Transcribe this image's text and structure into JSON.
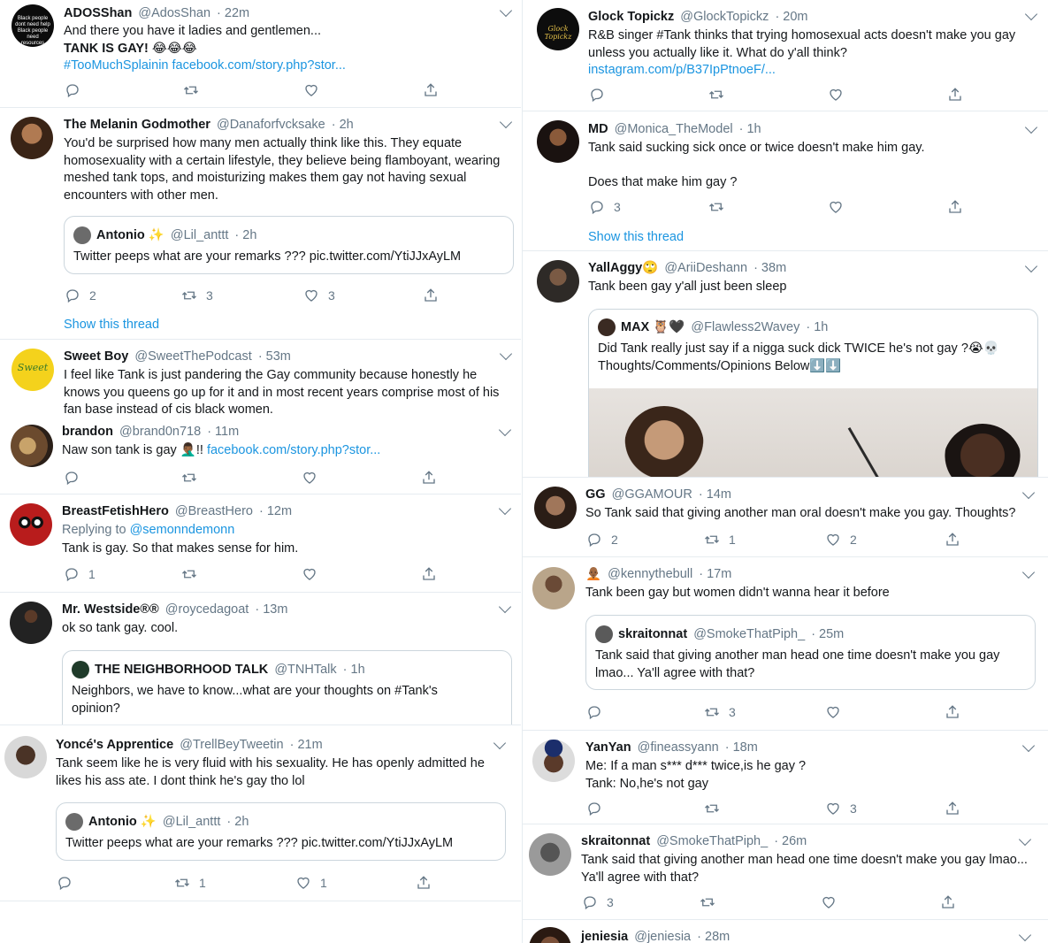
{
  "left": [
    {
      "name": "ADOSShan",
      "handle": "@AdosShan",
      "time": "· 22m",
      "lines": [
        "And there you have it ladies and gentlemen...",
        "TANK IS GAY! 😂😂😂"
      ],
      "links": [
        "#TooMuchSplainin facebook.com/story.php?stor..."
      ],
      "avatar_text": "Black people dont need help Black people need resources"
    },
    {
      "name": "The Melanin Godmother",
      "handle": "@Danaforfvcksake",
      "time": "· 2h",
      "text": "You'd be surprised how many men actually think like this. They equate homosexuality with a certain lifestyle, they believe being flamboyant, wearing meshed tank tops, and moisturizing makes them gay not having sexual encounters with other men.",
      "quote": {
        "name": "Antonio ✨",
        "handle": "@Lil_anttt",
        "time": "· 2h",
        "text": "Twitter peeps what are your remarks ??? pic.twitter.com/YtiJJxAyLM"
      },
      "counts": {
        "reply": "2",
        "retweet": "3",
        "like": "3"
      },
      "thread": "Show this thread"
    },
    {
      "name": "Sweet Boy",
      "handle": "@SweetThePodcast",
      "time": "· 53m",
      "text": "I feel like Tank is just pandering the Gay community because honestly he knows you queens go up for it and in most recent years comprise most of his fan base instead of cis black women.",
      "avatar_text": "Sweet"
    },
    {
      "name": "brandon",
      "handle": "@brand0n718",
      "time": "· 11m",
      "text_pre": "Naw son tank is gay 🤦🏾‍♂️!!",
      "link": "facebook.com/story.php?stor..."
    },
    {
      "name": "BreastFetishHero",
      "handle": "@BreastHero",
      "time": "· 12m",
      "replying": "Replying to",
      "replying_to": "@semonndemonn",
      "text": "Tank is gay. So that makes sense for him.",
      "counts": {
        "reply": "1"
      }
    },
    {
      "name": "Mr. Westside®®",
      "handle": "@roycedagoat",
      "time": "· 13m",
      "text": "ok so tank gay. cool.",
      "quote": {
        "name": "THE NEIGHBORHOOD TALK",
        "handle": "@TNHTalk",
        "time": "· 1h",
        "text": "Neighbors, we have to know...what are your thoughts on #Tank's opinion?"
      }
    },
    {
      "name": "Yoncé's Apprentice",
      "handle": "@TrellBeyTweetin",
      "time": "· 21m",
      "text": "Tank seem like he is very fluid with his sexuality. He has openly admitted he likes his ass ate. I dont think he's gay tho lol",
      "quote": {
        "name": "Antonio ✨",
        "handle": "@Lil_anttt",
        "time": "· 2h",
        "text": "Twitter peeps what are your remarks ??? pic.twitter.com/YtiJJxAyLM"
      },
      "counts": {
        "retweet": "1",
        "like": "1"
      }
    }
  ],
  "right": [
    {
      "name": "Glock Topickz",
      "handle": "@GlockTopickz",
      "time": "· 20m",
      "text": "R&B singer #Tank thinks that trying homosexual acts doesn't make you gay unless you actually like it. What do y'all think?",
      "link": "instagram.com/p/B37IpPtnoeF/...",
      "avatar_text": "Glock Topickz"
    },
    {
      "name": "MD",
      "handle": "@Monica_TheModel",
      "time": "· 1h",
      "lines": [
        "Tank said sucking sick once or twice doesn't make him gay.",
        "",
        "Does that make him gay ?"
      ],
      "counts": {
        "reply": "3"
      },
      "thread": "Show this thread"
    },
    {
      "name": "YallAggy🙄",
      "handle": "@AriiDeshann",
      "time": "· 38m",
      "text": "Tank been gay y'all just been sleep",
      "quote": {
        "name": "MAX 🦉🖤",
        "handle": "@Flawless2Wavey",
        "time": "· 1h",
        "text": "Did Tank really just say if a nigga suck dick TWICE he's not gay ?😭💀 Thoughts/Comments/Opinions Below⬇️⬇️"
      }
    },
    {
      "name": "GG",
      "handle": "@GGAMOUR",
      "time": "· 14m",
      "text": "So Tank said that giving another man oral doesn't make you gay. Thoughts?",
      "counts": {
        "reply": "2",
        "retweet": "1",
        "like": "2"
      }
    },
    {
      "name": "🧑🏾‍🦲",
      "handle": "@kennythebull",
      "time": "· 17m",
      "text": "Tank been gay but women didn't wanna hear it before",
      "quote": {
        "name": "skraitonnat",
        "handle": "@SmokeThatPiph_",
        "time": "· 25m",
        "text": "Tank said that giving another man head one time doesn't make you gay lmao... Ya'll agree with that?"
      },
      "counts": {
        "retweet": "3"
      }
    },
    {
      "name": "YanYan",
      "handle": "@fineassyann",
      "time": "· 18m",
      "lines": [
        "Me: If a man s*** d*** twice,is he gay ?",
        "Tank: No,he's not gay"
      ],
      "counts": {
        "like": "3"
      }
    },
    {
      "name": "skraitonnat",
      "handle": "@SmokeThatPiph_",
      "time": "· 26m",
      "text": "Tank said that giving another man head one time doesn't make you gay lmao... Ya'll agree with that?",
      "counts": {
        "reply": "3"
      }
    },
    {
      "name": "jeniesia",
      "handle": "@jeniesia",
      "time": "· 28m"
    }
  ]
}
